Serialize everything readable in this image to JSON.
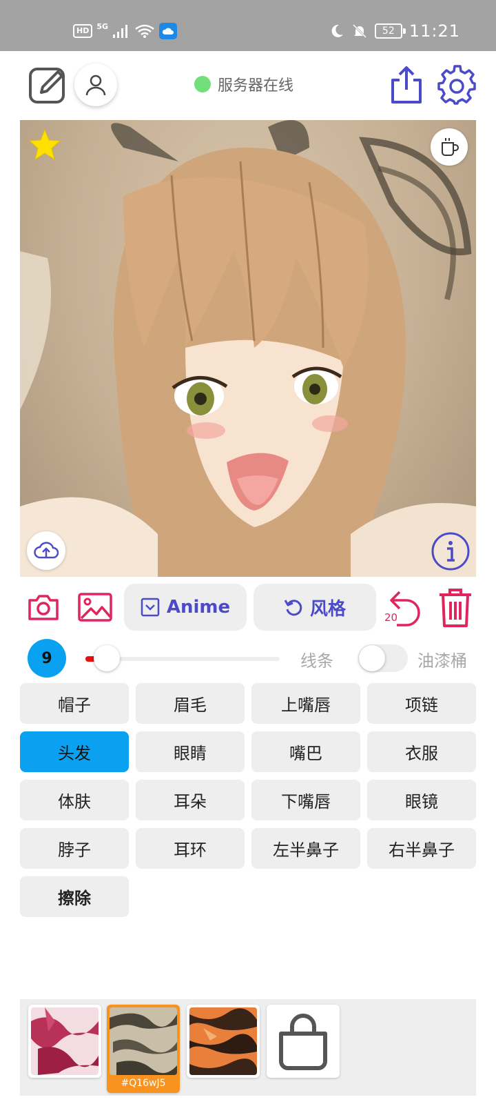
{
  "status_bar": {
    "hd": "HD",
    "network": "5G",
    "battery": "52",
    "time": "11:21"
  },
  "header": {
    "server_status": "服务器在线"
  },
  "toolbar": {
    "anime_label": "Anime",
    "style_label": "风格",
    "undo_count": "20"
  },
  "brush": {
    "size": "9",
    "size_fraction": 0.06,
    "line_label": "线条",
    "bucket_label": "油漆桶",
    "bucket_enabled": false
  },
  "parts": [
    "帽子",
    "眉毛",
    "上嘴唇",
    "项链",
    "头发",
    "眼睛",
    "嘴巴",
    "衣服",
    "体肤",
    "耳朵",
    "下嘴唇",
    "眼镜",
    "脖子",
    "耳环",
    "左半鼻子",
    "右半鼻子",
    "擦除"
  ],
  "selected_part": "头发",
  "textures": {
    "selected_code": "#Q16wJ5"
  },
  "colors": {
    "accent_blue": "#0aa2f0",
    "brand_purple": "#4b4bc8",
    "danger_pink": "#e0245e",
    "online_green": "#72e07a",
    "texture_selected": "#f7931e"
  }
}
